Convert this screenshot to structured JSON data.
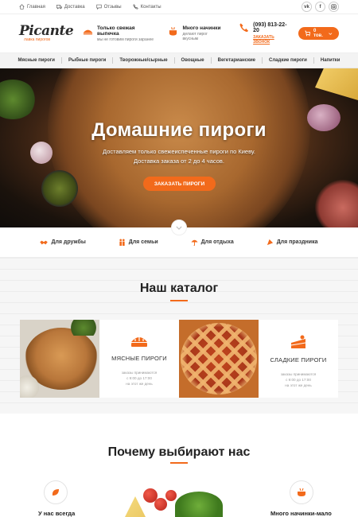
{
  "topbar": {
    "links": [
      "Главная",
      "Доставка",
      "Отзывы",
      "Контакты"
    ],
    "socials": [
      "vk",
      "f",
      "ig"
    ]
  },
  "header": {
    "logo_main": "Picante",
    "logo_sub": "лавка пирогов",
    "feature1_title": "Только свежая выпечка",
    "feature1_sub": "мы не готовим пироги заранее",
    "feature2_title": "Много начинки",
    "feature2_sub": "делают пирог вкусным",
    "phone": "(093) 813-22-20",
    "callback": "ЗАКАЗАТЬ ЗВОНОК",
    "cart_label": "0 тов."
  },
  "nav": [
    "Мясные пироги",
    "Рыбные пироги",
    "Творожные/сырные",
    "Овощные",
    "Вегетарианские",
    "Сладкие пироги",
    "Напитки"
  ],
  "hero": {
    "title": "Домашние пироги",
    "line1": "Доставляем только свежеиспеченные пироги по Киеву.",
    "line2": "Доставка заказа от 2 до 4 часов.",
    "button": "ЗАКАЗАТЬ ПИРОГИ"
  },
  "occasions": [
    "Для дружбы",
    "Для семьи",
    "Для отдыха",
    "Для праздника"
  ],
  "catalog": {
    "title": "Наш каталог",
    "cards": [
      {
        "name": "МЯСНЫЕ ПИРОГИ",
        "note1": "заказы принимаются",
        "note2": "с 9:00 до 17:00",
        "note3": "на этот же день"
      },
      {
        "name": "СЛАДКИЕ ПИРОГИ",
        "note1": "заказы принимаются",
        "note2": "с 9:00 до 17:00",
        "note3": "на этот же день"
      }
    ]
  },
  "why": {
    "title": "Почему выбирают нас",
    "left_label": "У нас всегда",
    "right_label": "Много начинки-мало"
  },
  "colors": {
    "accent": "#f26a1b",
    "text": "#222222"
  }
}
